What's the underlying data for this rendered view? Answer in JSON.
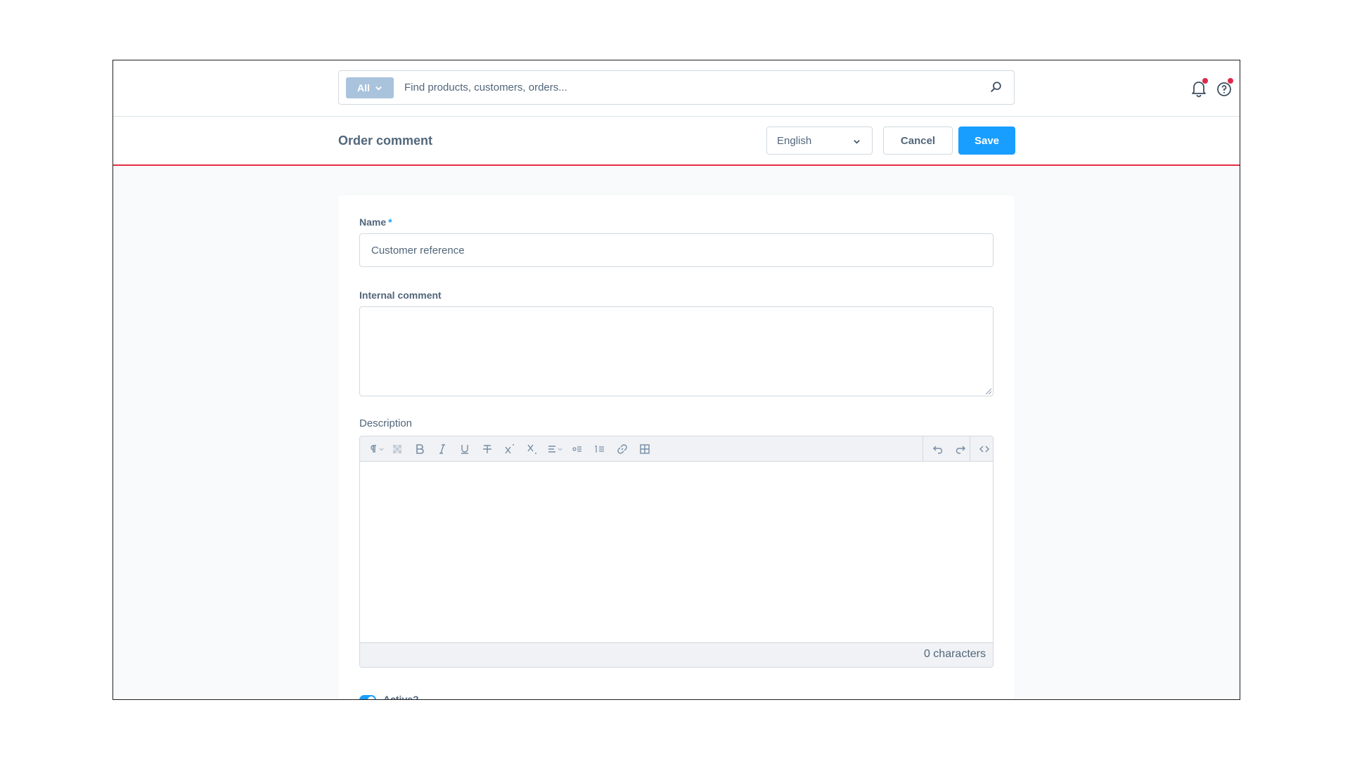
{
  "search": {
    "scope_label": "All",
    "placeholder": "Find products, customers, orders..."
  },
  "header": {
    "title": "Order comment",
    "language": "English",
    "cancel_label": "Cancel",
    "save_label": "Save"
  },
  "form": {
    "name_label": "Name",
    "required_marker": "*",
    "name_value": "Customer reference",
    "internal_comment_label": "Internal comment",
    "internal_comment_value": "",
    "description_label": "Description",
    "character_count": "0 characters",
    "active_label": "Active?",
    "active": true
  },
  "editor_toolbar": [
    "paragraph-format-icon",
    "clear-format-icon",
    "bold-icon",
    "italic-icon",
    "underline-icon",
    "strikethrough-icon",
    "superscript-icon",
    "subscript-icon",
    "align-icon",
    "bullet-list-icon",
    "numbered-list-icon",
    "link-icon",
    "table-icon",
    "undo-icon",
    "redo-icon",
    "code-view-icon"
  ],
  "colors": {
    "accent": "#189eff",
    "header_border": "#e52d43",
    "notification_dot": "#de294c",
    "scope_badge": "#a9c3dc"
  }
}
